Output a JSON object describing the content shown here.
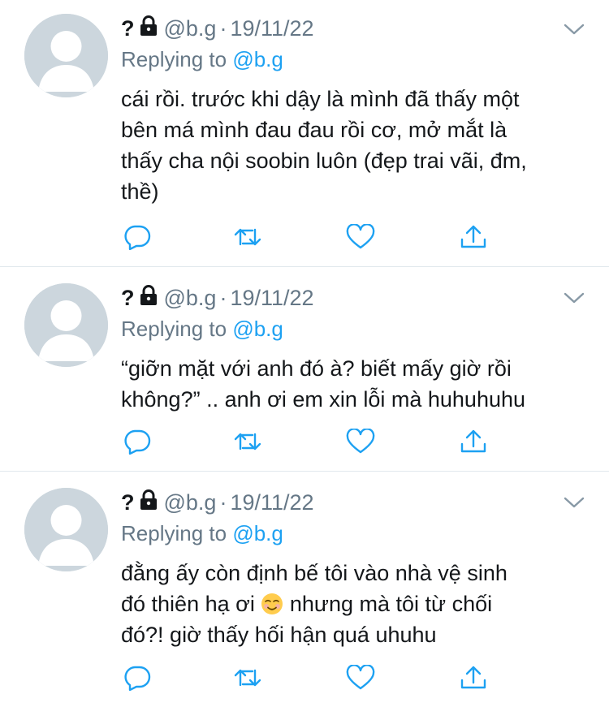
{
  "tweets": [
    {
      "name": "?",
      "lock_icon": "lock-icon",
      "handle": "@b.g",
      "separator": "·",
      "date": "19/11/22",
      "replying_prefix": "Replying to",
      "replying_to": "@b.g",
      "text_lines": [
        "cái rồi. trước khi dậy là mình đã thấy một",
        "bên má mình đau đau rồi cơ, mở mắt là",
        "thấy cha nội soobin luôn (đẹp trai vãi, đm,",
        "thề)"
      ]
    },
    {
      "name": "?",
      "lock_icon": "lock-icon",
      "handle": "@b.g",
      "separator": "·",
      "date": "19/11/22",
      "replying_prefix": "Replying to",
      "replying_to": "@b.g",
      "text_lines": [
        "“giỡn mặt với anh đó à? biết mấy giờ rồi",
        "không?” .. anh ơi em xin lỗi mà huhuhuhu"
      ]
    },
    {
      "name": "?",
      "lock_icon": "lock-icon",
      "handle": "@b.g",
      "separator": "·",
      "date": "19/11/22",
      "replying_prefix": "Replying to",
      "replying_to": "@b.g",
      "text_lines": [
        "đằng ấy còn định bế tôi vào nhà vệ sinh",
        "đó thiên hạ ơi",
        "nhưng mà tôi từ chối",
        "đó?! giờ thấy hối hận quá uhuhu"
      ],
      "emoji": "relieved-smiling-face-emoji"
    }
  ],
  "actions": [
    "reply-icon",
    "retweet-icon",
    "like-icon",
    "share-icon"
  ],
  "colors": {
    "text": "#14171a",
    "secondary": "#657786",
    "link": "#1da1f2",
    "divider": "#e1e8ed",
    "avatar_bg": "#ccd6dd",
    "icon": "#1da1f2"
  }
}
